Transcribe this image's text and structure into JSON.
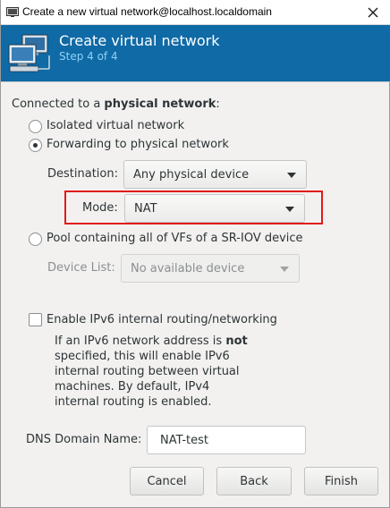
{
  "window": {
    "title": "Create a new virtual network@localhost.localdomain",
    "close_icon": "close-icon"
  },
  "header": {
    "title": "Create virtual network",
    "step": "Step 4 of 4",
    "icon": "network-computers-icon"
  },
  "connection": {
    "intro_prefix": "Connected to a ",
    "intro_bold": "physical network",
    "intro_suffix": ":",
    "options": [
      {
        "label": "Isolated virtual network",
        "checked": false
      },
      {
        "label": "Forwarding to physical network",
        "checked": true
      },
      {
        "label": "Pool containing all of VFs of a SR-IOV device",
        "checked": false
      }
    ],
    "destination": {
      "label": "Destination:",
      "value": "Any physical device"
    },
    "mode": {
      "label": "Mode:",
      "value": "NAT"
    },
    "device_list": {
      "label": "Device List:",
      "value": "No available device"
    }
  },
  "ipv6": {
    "label": "Enable IPv6 internal routing/networking",
    "checked": false,
    "info_line1_prefix": "If an IPv6 network address is ",
    "info_line1_bold": "not",
    "info_lines": [
      "specified, this will enable IPv6",
      "internal routing between virtual",
      "machines.  By default, IPv4",
      "internal routing is enabled."
    ]
  },
  "dns": {
    "label": "DNS Domain Name:",
    "value": "NAT-test"
  },
  "buttons": {
    "cancel": "Cancel",
    "back": "Back",
    "finish": "Finish"
  },
  "colors": {
    "banner": "#0f6aa6",
    "step_text": "#8fd2f7",
    "highlight": "#e11a1a"
  }
}
